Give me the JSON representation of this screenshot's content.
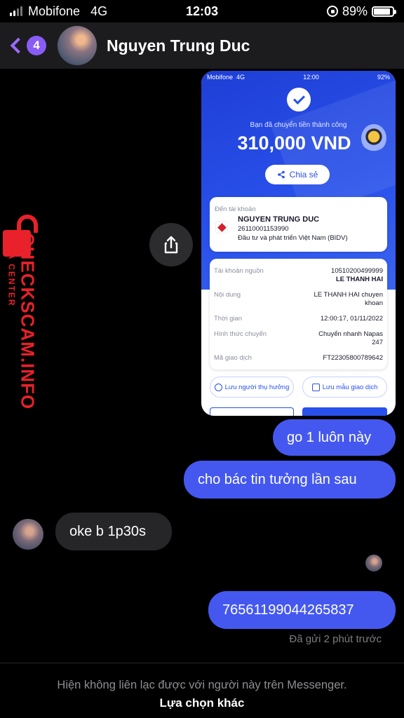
{
  "status_bar": {
    "carrier": "Mobifone",
    "network": "4G",
    "time": "12:03",
    "battery": "89%",
    "battery_level": 0.89
  },
  "header": {
    "back_badge": "4",
    "contact_name": "Nguyen Trung Duc"
  },
  "watermark": {
    "brand": "CHECKSCAM.INFO",
    "tagline": "DATA CENTER",
    "color": "#e8212a"
  },
  "receipt": {
    "status_bar": {
      "carrier": "Mobifone",
      "network": "4G",
      "time": "12:00",
      "battery": "92%"
    },
    "success_text": "Bạn đã chuyển tiền thành công",
    "amount": "310,000 VND",
    "share_label": "Chia sẻ",
    "to_account_label": "Đến tài khoản",
    "recipient_name": "NGUYEN TRUNG DUC",
    "recipient_account": "26110001153990",
    "recipient_bank": "Đầu tư và phát triển Việt Nam (BIDV)",
    "rows": [
      {
        "key": "Tài khoản nguồn",
        "value": "10510200499999",
        "value2": "LE THANH HAI"
      },
      {
        "key": "Nội dung",
        "value": "LE THANH HAI chuyen",
        "value2": "khoan"
      },
      {
        "key": "Thời gian",
        "value": "12:00:17, 01/11/2022",
        "value2": ""
      },
      {
        "key": "Hình thức chuyển",
        "value": "Chuyển nhanh Napas",
        "value2": "247"
      },
      {
        "key": "Mã giao dịch",
        "value": "FT22305800789642",
        "value2": ""
      }
    ],
    "save_recipient": "Lưu người thụ hưởng",
    "save_template": "Lưu mẫu giao dịch",
    "accent": "#2850ea"
  },
  "messages": [
    {
      "direction": "out",
      "text": "go 1 luôn này"
    },
    {
      "direction": "out",
      "text": "cho bác tin tưởng lần sau"
    },
    {
      "direction": "in",
      "text": "oke b 1p30s"
    },
    {
      "direction": "out",
      "text": "76561199044265837"
    }
  ],
  "sent_status": "Đã gửi 2 phút trước",
  "footer": {
    "notice": "Hiện không liên lạc được với người này trên Messenger.",
    "action": "Lựa chọn khác"
  },
  "colors": {
    "outgoing_bubble": "#4458f0",
    "incoming_bubble": "#262628",
    "back_accent": "#9b6bff"
  }
}
